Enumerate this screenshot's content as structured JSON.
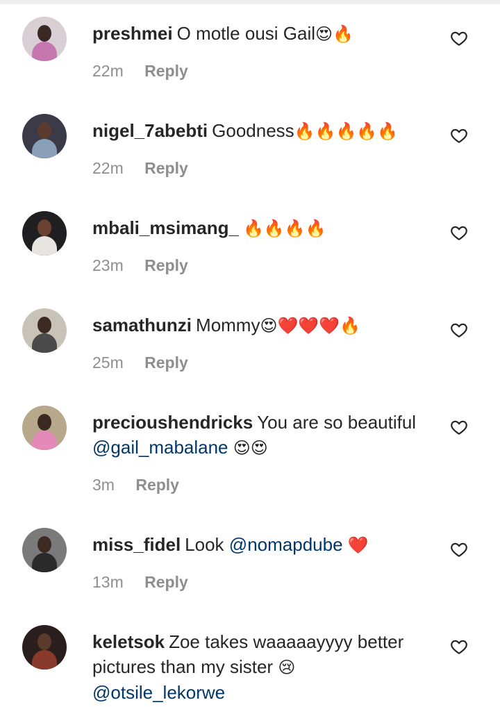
{
  "comments": [
    {
      "username": "preshmei",
      "text": "O motle ousi Gail",
      "emojis": "😍🔥",
      "time": "22m",
      "reply": "Reply",
      "avatar_colors": {
        "bg": "#d8d0d4",
        "head": "#3b2a24",
        "body": "#c777b0"
      }
    },
    {
      "username": "nigel_7abebti",
      "text": "Goodness",
      "emojis": "🔥🔥🔥🔥🔥",
      "time": "22m",
      "reply": "Reply",
      "avatar_colors": {
        "bg": "#3a3a48",
        "head": "#5b3b2d",
        "body": "#8aa0b8"
      }
    },
    {
      "username": "mbali_msimang_",
      "text": "",
      "emojis": "🔥🔥🔥🔥",
      "time": "23m",
      "reply": "Reply",
      "avatar_colors": {
        "bg": "#1f1f22",
        "head": "#6a4030",
        "body": "#e8e4e0"
      }
    },
    {
      "username": "samathunzi",
      "text": "Mommy",
      "emojis": "😍❤️❤️❤️🔥",
      "time": "25m",
      "reply": "Reply",
      "avatar_colors": {
        "bg": "#c9c2b8",
        "head": "#3d2a20",
        "body": "#4a4a4a"
      }
    },
    {
      "username": "precioushendricks",
      "text": "You are so beautiful",
      "mention": "@gail_mabalane",
      "emojis": "😍😍",
      "time": "3m",
      "reply": "Reply",
      "avatar_colors": {
        "bg": "#b8a88c",
        "head": "#3a2a22",
        "body": "#e48ab8"
      }
    },
    {
      "username": "miss_fidel",
      "text": "Look",
      "mention": "@nomapdube",
      "emojis": "❤️",
      "time": "13m",
      "reply": "Reply",
      "avatar_colors": {
        "bg": "#7a7a7a",
        "head": "#3b2b22",
        "body": "#2a2a2a"
      }
    },
    {
      "username": "keletsok",
      "text": "Zoe takes waaaaayyyy better pictures than my sister",
      "emojis": "😢",
      "mention": "@otsile_lekorwe",
      "time": "",
      "reply": "",
      "avatar_colors": {
        "bg": "#2a1f1c",
        "head": "#5a3a2a",
        "body": "#8a3a2a"
      }
    }
  ],
  "icons": {
    "like": "heart-outline-icon"
  }
}
